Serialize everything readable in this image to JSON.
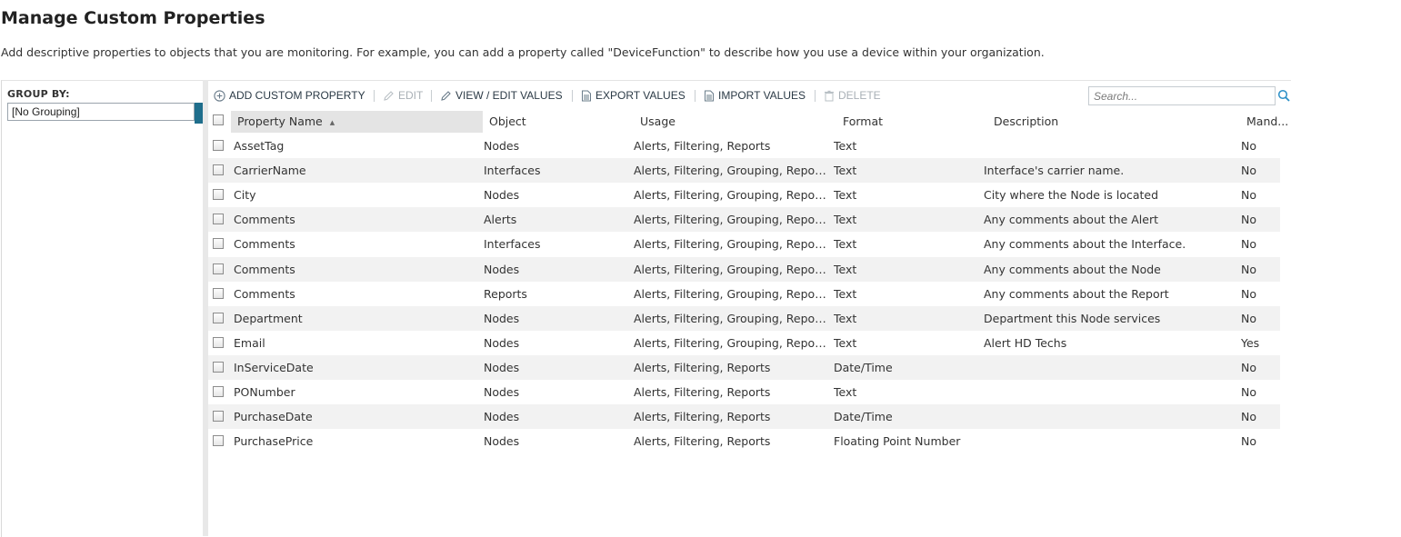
{
  "page": {
    "title": "Manage Custom Properties",
    "description": "Add descriptive properties to objects that you are monitoring. For example, you can add a property called \"DeviceFunction\" to describe how you use a device within your organization."
  },
  "group_panel": {
    "label": "GROUP BY:",
    "selected": "[No Grouping]"
  },
  "toolbar": {
    "add_label": "ADD CUSTOM PROPERTY",
    "edit_label": "EDIT",
    "view_edit_label": "VIEW / EDIT VALUES",
    "export_label": "EXPORT VALUES",
    "import_label": "IMPORT VALUES",
    "delete_label": "DELETE",
    "search_placeholder": "Search..."
  },
  "table": {
    "columns": [
      "Property Name",
      "Object",
      "Usage",
      "Format",
      "Description",
      "Mand..."
    ],
    "sorted_column": "Property Name",
    "sort_indicator": "▲",
    "rows": [
      {
        "name": "AssetTag",
        "object": "Nodes",
        "usage": "Alerts, Filtering, Reports",
        "format": "Text",
        "description": "",
        "mandatory": "No"
      },
      {
        "name": "CarrierName",
        "object": "Interfaces",
        "usage": "Alerts, Filtering, Grouping, Reports",
        "format": "Text",
        "description": "Interface's carrier name.",
        "mandatory": "No"
      },
      {
        "name": "City",
        "object": "Nodes",
        "usage": "Alerts, Filtering, Grouping, Reports",
        "format": "Text",
        "description": "City where the Node is located",
        "mandatory": "No"
      },
      {
        "name": "Comments",
        "object": "Alerts",
        "usage": "Alerts, Filtering, Grouping, Reports",
        "format": "Text",
        "description": "Any comments about the Alert",
        "mandatory": "No"
      },
      {
        "name": "Comments",
        "object": "Interfaces",
        "usage": "Alerts, Filtering, Grouping, Reports",
        "format": "Text",
        "description": "Any comments about the Interface.",
        "mandatory": "No"
      },
      {
        "name": "Comments",
        "object": "Nodes",
        "usage": "Alerts, Filtering, Grouping, Reports",
        "format": "Text",
        "description": "Any comments about the Node",
        "mandatory": "No"
      },
      {
        "name": "Comments",
        "object": "Reports",
        "usage": "Alerts, Filtering, Grouping, Reports",
        "format": "Text",
        "description": "Any comments about the Report",
        "mandatory": "No"
      },
      {
        "name": "Department",
        "object": "Nodes",
        "usage": "Alerts, Filtering, Grouping, Reports",
        "format": "Text",
        "description": "Department this Node services",
        "mandatory": "No"
      },
      {
        "name": "Email",
        "object": "Nodes",
        "usage": "Alerts, Filtering, Grouping, Reports",
        "format": "Text",
        "description": "Alert HD Techs",
        "mandatory": "Yes"
      },
      {
        "name": "InServiceDate",
        "object": "Nodes",
        "usage": "Alerts, Filtering, Reports",
        "format": "Date/Time",
        "description": "",
        "mandatory": "No"
      },
      {
        "name": "PONumber",
        "object": "Nodes",
        "usage": "Alerts, Filtering, Reports",
        "format": "Text",
        "description": "",
        "mandatory": "No"
      },
      {
        "name": "PurchaseDate",
        "object": "Nodes",
        "usage": "Alerts, Filtering, Reports",
        "format": "Date/Time",
        "description": "",
        "mandatory": "No"
      },
      {
        "name": "PurchasePrice",
        "object": "Nodes",
        "usage": "Alerts, Filtering, Reports",
        "format": "Floating Point Number",
        "description": "",
        "mandatory": "No"
      }
    ]
  },
  "colors": {
    "accent": "#1f6e8c",
    "row_alt": "#f2f2f2",
    "sorted_header": "#e4e4e4"
  }
}
